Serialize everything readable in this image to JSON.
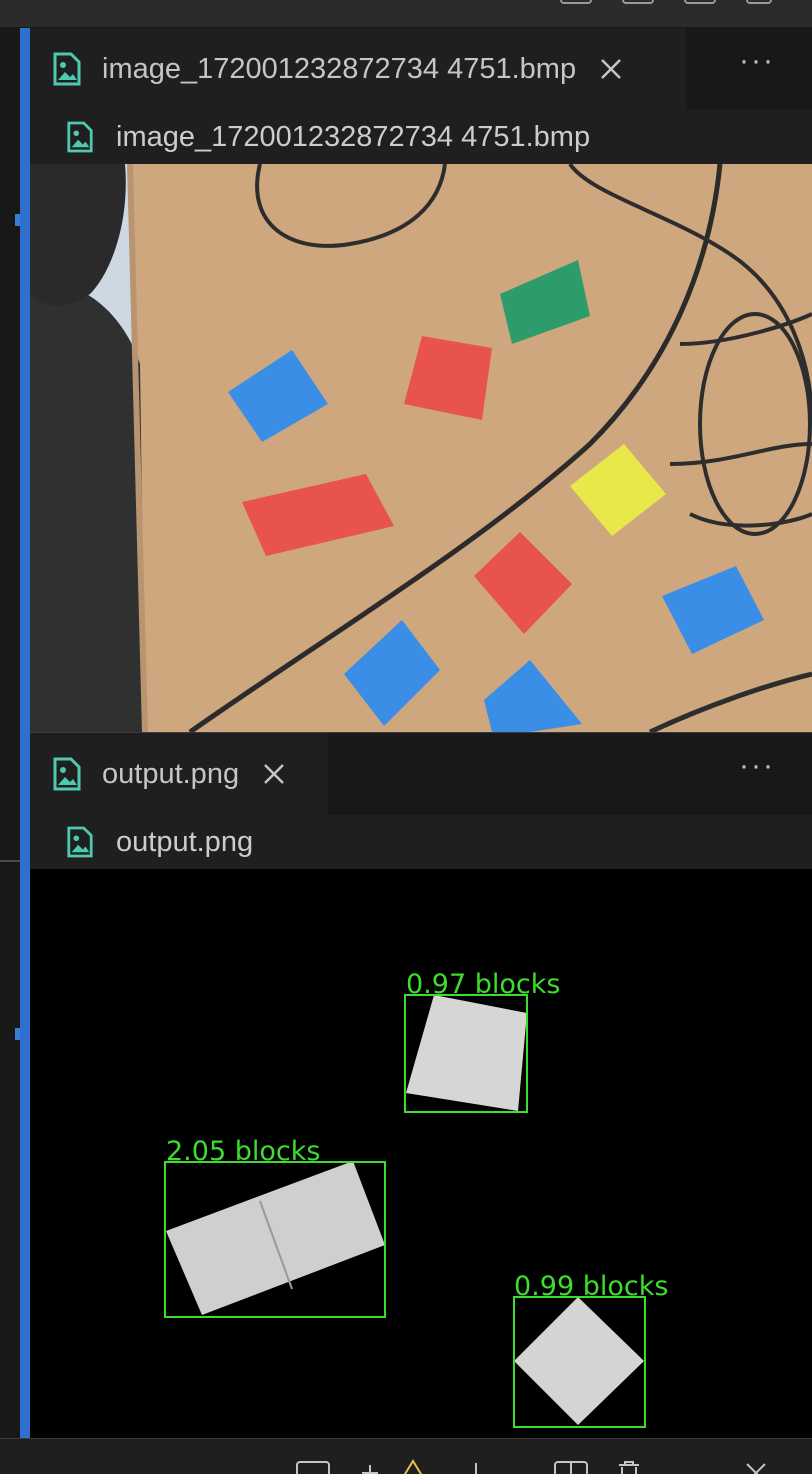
{
  "editor_top": {
    "tab_title": "image_172001232872734 4751.bmp",
    "breadcrumb": "image_172001232872734 4751.bmp"
  },
  "editor_bottom": {
    "tab_title": "output.png",
    "breadcrumb": "output.png"
  },
  "detections": [
    {
      "label": "0.97 blocks"
    },
    {
      "label": "2.05 blocks"
    },
    {
      "label": "0.99 blocks"
    }
  ],
  "colors": {
    "file_icon": "#4ec9b0",
    "focus_bar": "#2f6fd0",
    "detection_box": "#3ddc2f",
    "block_red": "#e8534e",
    "block_blue": "#3a8ee6",
    "block_green": "#2e9c6a",
    "block_yellow": "#e9e84a"
  },
  "icons": {
    "file": "image-file-icon",
    "close": "close-icon",
    "more": "more-actions-icon"
  }
}
